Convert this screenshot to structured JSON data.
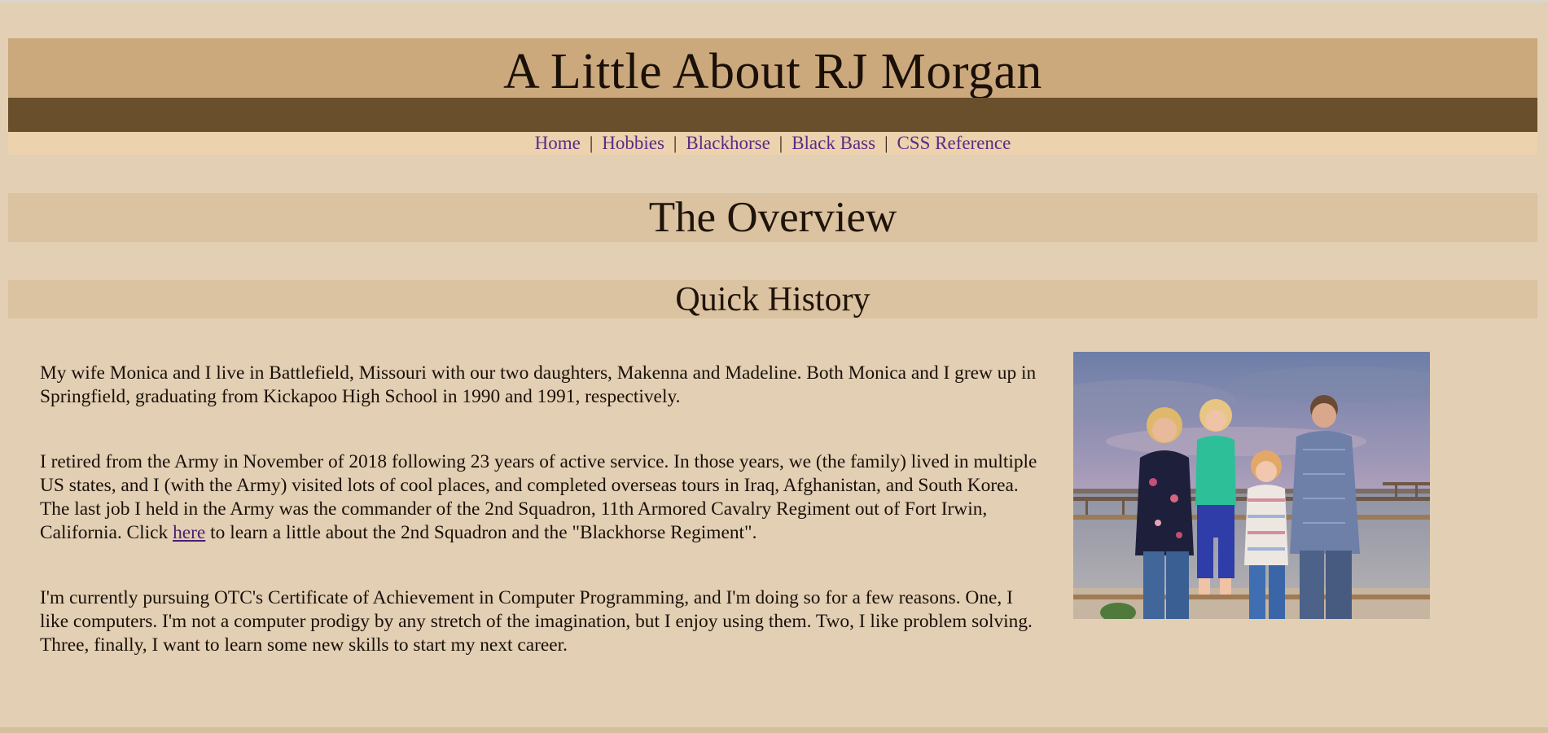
{
  "header": {
    "title": "A Little About RJ Morgan"
  },
  "nav": {
    "items": [
      {
        "label": "Home"
      },
      {
        "label": "Hobbies"
      },
      {
        "label": "Blackhorse"
      },
      {
        "label": "Black Bass"
      },
      {
        "label": "CSS Reference"
      }
    ],
    "separator": "|"
  },
  "overview": {
    "heading": "The Overview"
  },
  "history": {
    "heading": "Quick History",
    "p1": "My wife Monica and I live in Battlefield, Missouri with our two daughters, Makenna and Madeline. Both Monica and I grew up in Springfield, graduating from Kickapoo High School in 1990 and 1991, respectively.",
    "p2_before": "I retired from the Army in November of 2018 following 23 years of active service. In those years, we (the family) lived in multiple US states, and I (with the Army) visited lots of cool places, and completed overseas tours in Iraq, Afghanistan, and South Korea. The last job I held in the Army was the commander of the 2nd Squadron, 11th Armored Cavalry Regiment out of Fort Irwin, California. Click ",
    "p2_link": "here",
    "p2_after": " to learn a little about the 2nd Squadron and the \"Blackhorse Regiment\".",
    "p3": "I'm currently pursuing OTC's Certificate of Achievement in Computer Programming, and I'm doing so for a few reasons. One, I like computers. I'm not a computer prodigy by any stretch of the imagination, but I enjoy using them. Two, I like problem solving. Three, finally, I want to learn some new skills to start my next career."
  },
  "colors": {
    "page_bg": "#e2cfb4",
    "header_bg": "#cba97d",
    "dark_bar": "#6a4f2c",
    "nav_bg": "#ecd2ad",
    "section_bg": "#dbc2a1",
    "link": "#5b2b86"
  }
}
